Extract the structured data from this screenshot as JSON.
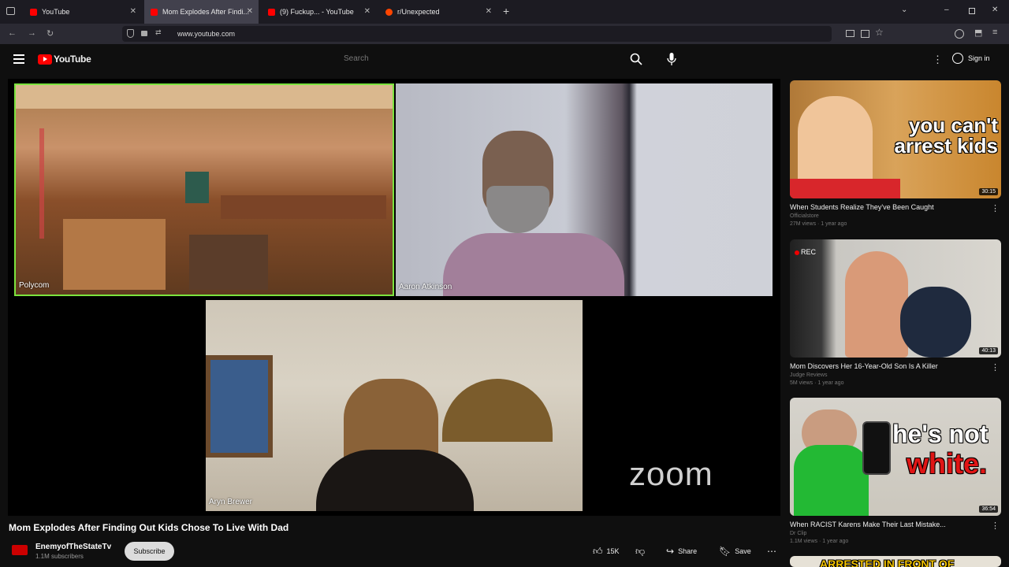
{
  "browser": {
    "tabs": [
      {
        "label": "YouTube",
        "favicon_color": "#ff0000"
      },
      {
        "label": "Mom Explodes After Findi...",
        "favicon_color": "#ff0000"
      },
      {
        "label": "(9) Fuckup... - YouTube",
        "favicon_color": "#ff0000"
      },
      {
        "label": "r/Unexpected",
        "favicon_color": "#ff4500"
      }
    ],
    "url": "www.youtube.com"
  },
  "header": {
    "logo_text": "YouTube",
    "search_placeholder": "Search",
    "signin_label": "Sign in"
  },
  "player": {
    "participants": [
      {
        "name": "Polycom"
      },
      {
        "name": "Aaron Atkinson"
      },
      {
        "name": "Aryn Brewer"
      }
    ],
    "watermark": "zoom"
  },
  "video": {
    "title": "Mom Explodes After Finding Out Kids Chose To Live With Dad",
    "channel": "EnemyofTheStateTv",
    "subscribers": "1.1M subscribers",
    "subscribe_label": "Subscribe",
    "likes": "15K",
    "share_label": "Share",
    "save_label": "Save"
  },
  "sidebar": {
    "items": [
      {
        "title": "When Students Realize They've Been Caught",
        "channel": "Officialstore",
        "meta": "27M views · 1 year ago",
        "duration": "30:15",
        "overlay": "you can't arrest kids"
      },
      {
        "title": "Mom Discovers Her 16-Year-Old Son Is A Killer",
        "channel": "Judge Reviews",
        "meta": "5M views · 1 year ago",
        "duration": "40:13",
        "overlay": "REC"
      },
      {
        "title": "When RACIST Karens Make Their Last Mistake...",
        "channel": "Dr Clip",
        "meta": "1.1M views · 1 year ago",
        "duration": "36:54",
        "overlay_line1": "he's not",
        "overlay_line2": "white."
      },
      {
        "overlay": "ARRESTED IN FRONT OF"
      }
    ]
  },
  "colors": {
    "accent": "#ff0000",
    "active_speaker": "#7ce33e"
  }
}
